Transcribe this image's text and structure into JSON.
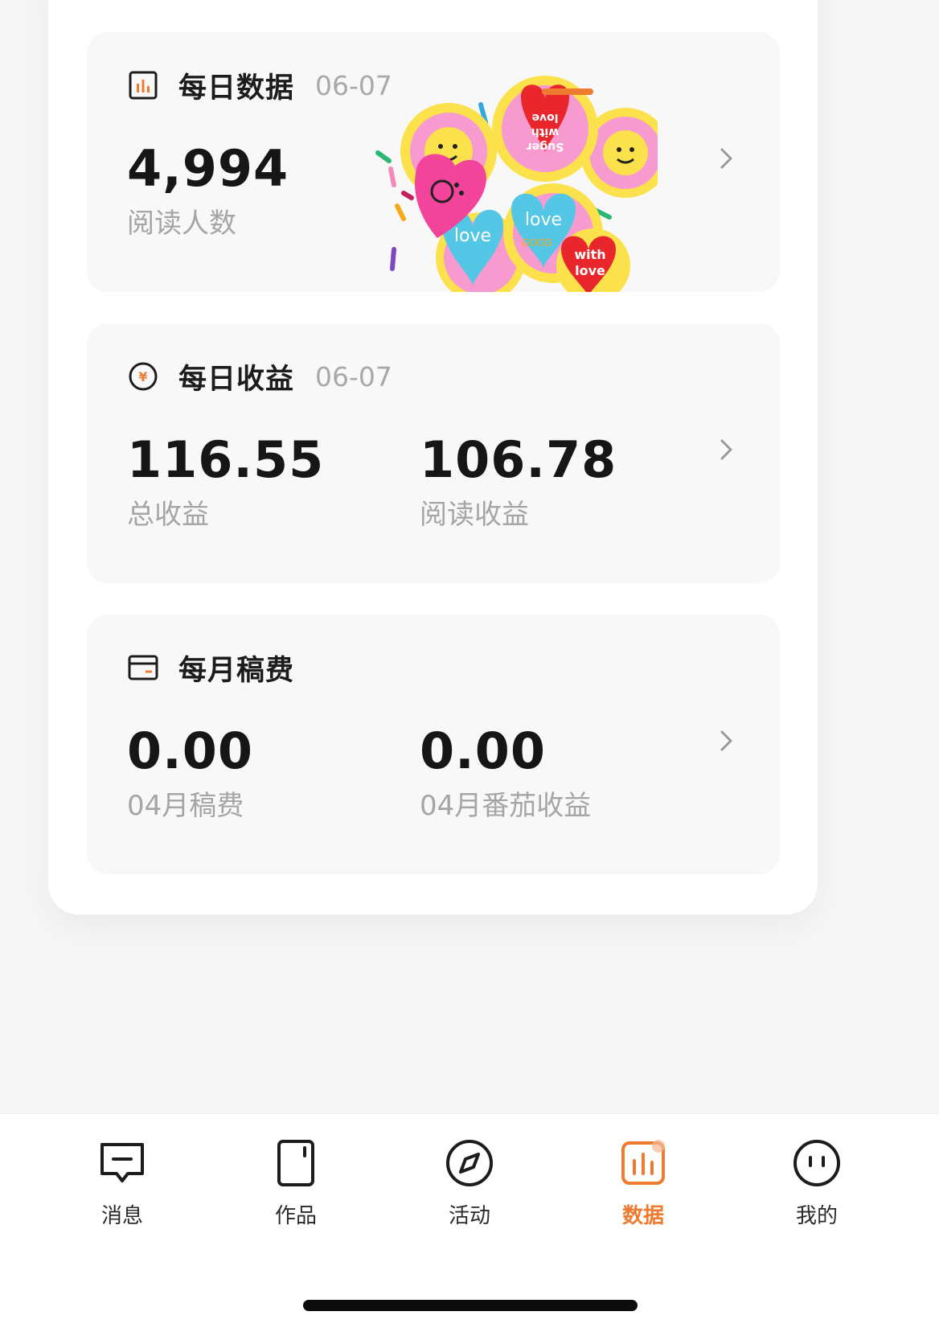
{
  "cards": {
    "daily_data": {
      "title": "每日数据",
      "date": "06-07",
      "value": "4,994",
      "label": "阅读人数",
      "sticker_texts": [
        "love",
        "Suger with love",
        "love GOOD",
        "Suger with love",
        "love GOOD"
      ]
    },
    "daily_income": {
      "title": "每日收益",
      "date": "06-07",
      "total_value": "116.55",
      "total_label": "总收益",
      "read_value": "106.78",
      "read_label": "阅读收益"
    },
    "monthly_fee": {
      "title": "每月稿费",
      "fee_value": "0.00",
      "fee_label": "04月稿费",
      "fanqie_value": "0.00",
      "fanqie_label": "04月番茄收益"
    }
  },
  "tabbar": {
    "active": "数据",
    "accent": "#ee7b30",
    "tabs": [
      {
        "label": "消息",
        "icon": "message-icon"
      },
      {
        "label": "作品",
        "icon": "works-icon"
      },
      {
        "label": "活动",
        "icon": "compass-icon"
      },
      {
        "label": "数据",
        "icon": "data-chart-icon"
      },
      {
        "label": "我的",
        "icon": "profile-face-icon"
      }
    ]
  }
}
